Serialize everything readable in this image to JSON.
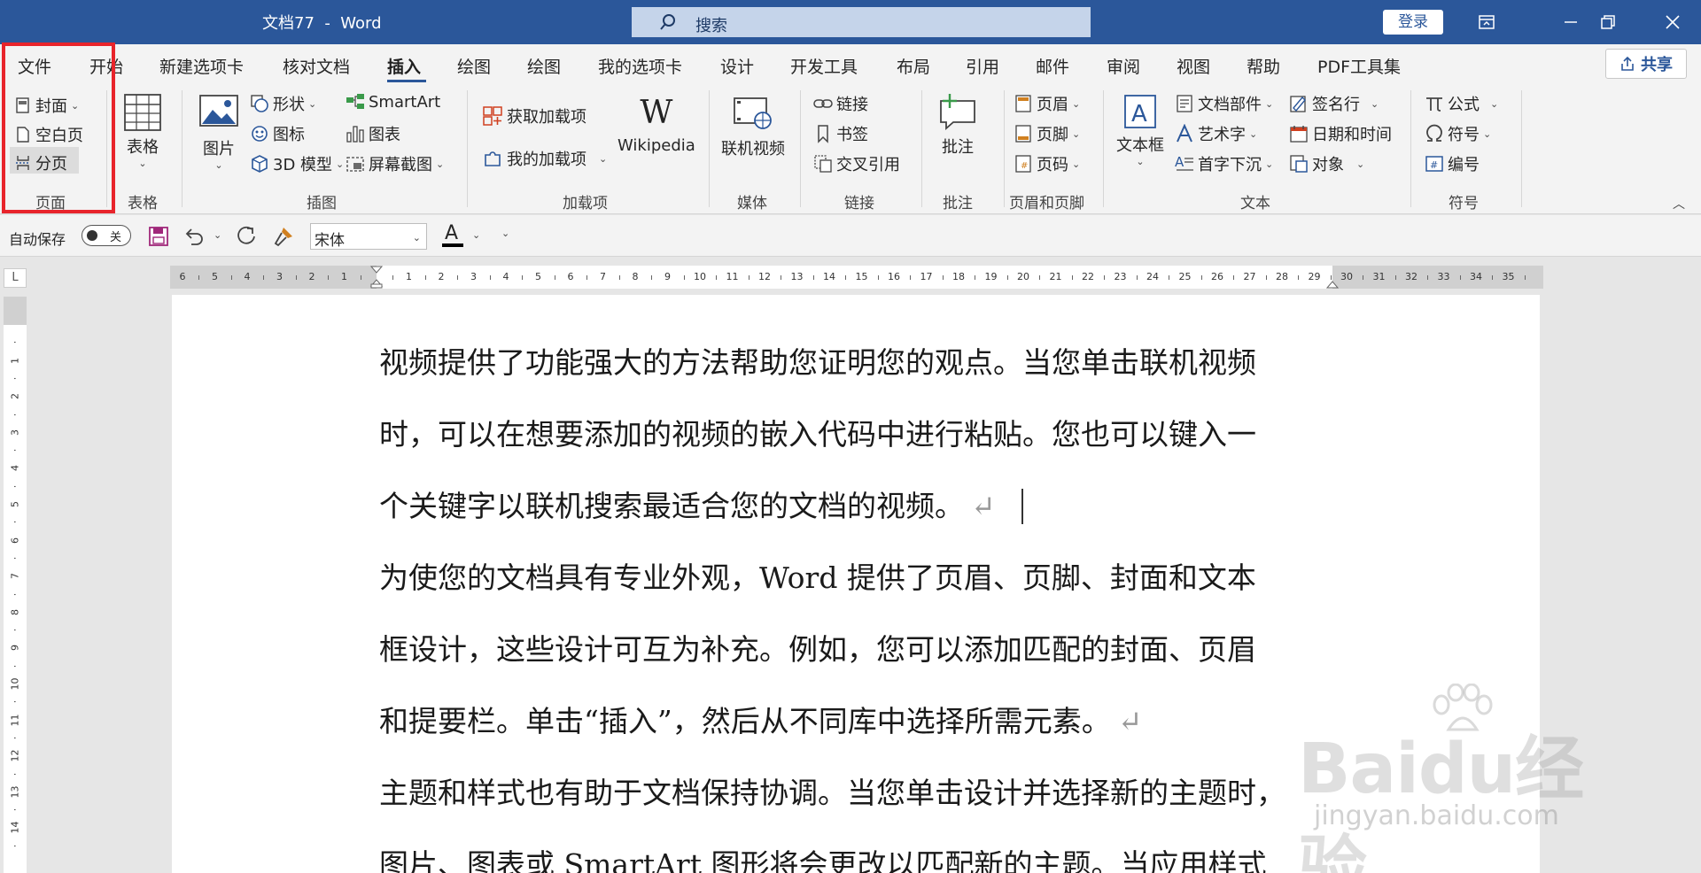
{
  "app": {
    "title": "文档77  -  Word",
    "search_placeholder": "搜索",
    "login_label": "登录"
  },
  "tabs": [
    {
      "label": "文件"
    },
    {
      "label": "开始"
    },
    {
      "label": "新建选项卡"
    },
    {
      "label": "核对文档"
    },
    {
      "label": "插入"
    },
    {
      "label": "绘图"
    },
    {
      "label": "绘图"
    },
    {
      "label": "我的选项卡"
    },
    {
      "label": "设计"
    },
    {
      "label": "开发工具"
    },
    {
      "label": "布局"
    },
    {
      "label": "引用"
    },
    {
      "label": "邮件"
    },
    {
      "label": "审阅"
    },
    {
      "label": "视图"
    },
    {
      "label": "帮助"
    },
    {
      "label": "PDF工具集"
    }
  ],
  "share_label": "共享",
  "ribbon": {
    "pages": {
      "cover": "封面",
      "blank": "空白页",
      "break": "分页",
      "label": "页面"
    },
    "table": {
      "button": "表格",
      "label": "表格"
    },
    "illustrations": {
      "pictures": "图片",
      "shapes": "形状",
      "icons": "图标",
      "model3d": "3D 模型",
      "smartart": "SmartArt",
      "chart": "图表",
      "screenshot": "屏幕截图",
      "label": "插图"
    },
    "addins": {
      "get": "获取加载项",
      "mine": "我的加载项",
      "wikipedia": "Wikipedia",
      "label": "加载项"
    },
    "media": {
      "video": "联机视频",
      "label": "媒体"
    },
    "links": {
      "link": "链接",
      "bookmark": "书签",
      "crossref": "交叉引用",
      "label": "链接"
    },
    "comments": {
      "comment": "批注",
      "label": "批注"
    },
    "headerfooter": {
      "header": "页眉",
      "footer": "页脚",
      "pagenum": "页码",
      "label": "页眉和页脚"
    },
    "text": {
      "textbox": "文本框",
      "parts": "文档部件",
      "wordart": "艺术字",
      "dropcap": "首字下沉",
      "signature": "签名行",
      "datetime": "日期和时间",
      "object": "对象",
      "label": "文本"
    },
    "symbols": {
      "equation": "公式",
      "symbol": "符号",
      "number": "编号",
      "label": "符号"
    }
  },
  "qat": {
    "autosave_label": "自动保存",
    "autosave_state": "关",
    "font_name": "宋体",
    "font_color_letter": "A"
  },
  "document": {
    "lines": [
      "视频提供了功能强大的方法帮助您证明您的观点。当您单击联机视频",
      "时，可以在想要添加的视频的嵌入代码中进行粘贴。您也可以键入一",
      "个关键字以联机搜索最适合您的文档的视频。",
      "为使您的文档具有专业外观，Word 提供了页眉、页脚、封面和文本",
      "框设计，这些设计可互为补充。例如，您可以添加匹配的封面、页眉",
      "和提要栏。单击“插入”，然后从不同库中选择所需元素。",
      "主题和样式也有助于文档保持协调。当您单击设计并选择新的主题时，",
      "图片、图表或 SmartArt 图形将会更改以匹配新的主题。当应用样式"
    ],
    "paragraph_mark": "↵"
  },
  "watermark": {
    "brand": "Baidu经验",
    "url": "jingyan.baidu.com"
  },
  "colors": {
    "titlebar": "#2b579a",
    "highlight_box": "#e8242b"
  }
}
